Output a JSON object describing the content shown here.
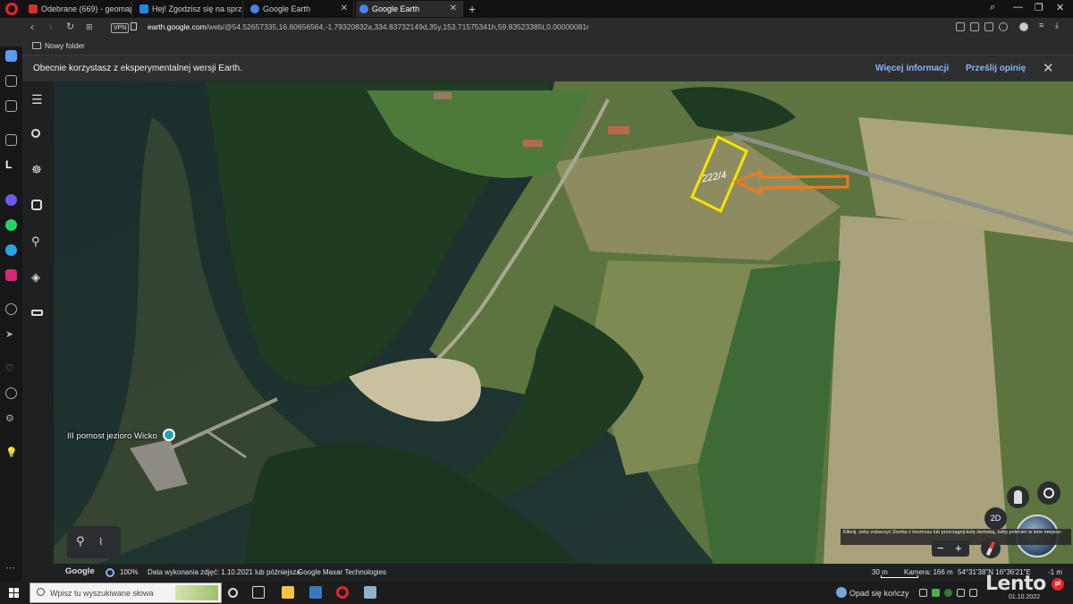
{
  "browser": {
    "tabs": [
      {
        "title": "Odebrane (669) - geomap",
        "favicon_color": "#d93025",
        "active": false
      },
      {
        "title": "Hej! Zgodzisz się na sprzed",
        "favicon_color": "#1e88e5",
        "active": false
      },
      {
        "title": "Google Earth",
        "favicon_color": "#4285f4",
        "active": false
      },
      {
        "title": "Google Earth",
        "favicon_color": "#4285f4",
        "active": true
      }
    ],
    "new_tab_label": "+",
    "vpn_label": "VPN",
    "url_domain": "earth.google.com",
    "url_path": "/web/@54.52657335,16.60656564,-1.79320832a,334.83732149d,35y,153.71575341h,59.83523385t,0.00000081r",
    "bookmark_folder": "Nowy folder"
  },
  "notice": {
    "text": "Obecnie korzystasz z eksperymentalnej wersji Earth.",
    "more_info": "Więcej informacji",
    "feedback": "Prześlij opinię",
    "close": "✕"
  },
  "map": {
    "place_label": "III pomost jezioro Wicko",
    "parcel_label": "222/4",
    "parcel_color": "#f2e600",
    "arrow_color": "#f07a1e",
    "mode_button": "2D",
    "tooltip": "Kliknij, żeby zobaczyć Ziemię z kosmosu lub przeciągnij kulę ziemską, żeby polecieć w inne miejsce.",
    "zoom_out": "−",
    "zoom_in": "+"
  },
  "statusbar": {
    "google": "Google",
    "loading": "100%",
    "imagery_date": "Data wykonania zdjęć: 1.10.2021 lub późniejsza",
    "attribution": "Google   Maxar Technologies",
    "scale": "30 m",
    "camera": "Kamera: 166 m",
    "coords": "54°31'38\"N 16°36'21\"E",
    "elevation": "-1 m"
  },
  "taskbar": {
    "search_placeholder": "Wpisz tu wyszukiwane słowa",
    "weather": "Opad się kończy",
    "date": "01.10.2022"
  },
  "watermark": {
    "text": "Lento",
    "suffix": "pl"
  }
}
